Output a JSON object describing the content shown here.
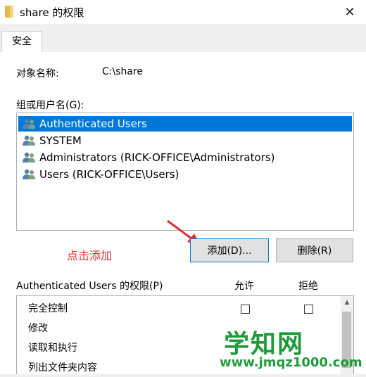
{
  "window": {
    "title": "share 的权限",
    "close_glyph": "✕"
  },
  "tabs": [
    {
      "label": "安全"
    }
  ],
  "object": {
    "label": "对象名称:",
    "value": "C:\\share"
  },
  "groups": {
    "label": "组或用户名(G):",
    "items": [
      {
        "label": "Authenticated Users",
        "selected": true
      },
      {
        "label": "SYSTEM",
        "selected": false
      },
      {
        "label": "Administrators (RICK-OFFICE\\Administrators)",
        "selected": false
      },
      {
        "label": "Users (RICK-OFFICE\\Users)",
        "selected": false
      }
    ]
  },
  "annotation": "点击添加",
  "buttons": {
    "add": "添加(D)...",
    "remove": "删除(R)"
  },
  "permissions": {
    "label": "Authenticated Users 的权限(P)",
    "allow_header": "允许",
    "deny_header": "拒绝",
    "rows": [
      {
        "label": "完全控制"
      },
      {
        "label": "修改"
      },
      {
        "label": "读取和执行"
      },
      {
        "label": "列出文件夹内容"
      }
    ]
  },
  "watermark": {
    "text": "学知网",
    "url": "www.jmqz1000.com"
  },
  "colors": {
    "selection": "#0078d7",
    "annotation": "#e03030",
    "watermark": "#1f9a3a"
  }
}
